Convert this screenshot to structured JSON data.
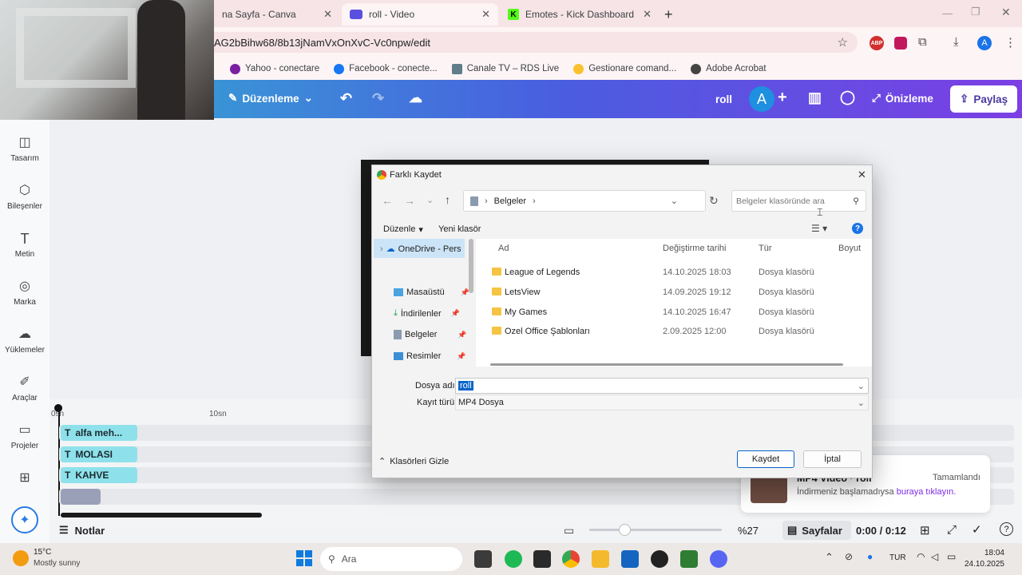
{
  "browser": {
    "tabs": [
      {
        "label": "na Sayfa - Canva"
      },
      {
        "label": "roll - Video"
      },
      {
        "label": "Emotes - Kick Dashboard"
      }
    ],
    "url": "AG2bBihw68/8b13jNamVxOnXvC-Vc0npw/edit",
    "bookmarks": [
      "Yahoo - conectare",
      "Facebook - conecte...",
      "Canale TV – RDS Live",
      "Gestionare comand...",
      "Adobe Acrobat"
    ],
    "colors": {
      "tabbar": "#f6e4e6",
      "toolbar": "#fdf4f5"
    }
  },
  "canva": {
    "header": {
      "edit_menu": "Düzenleme",
      "title": "roll",
      "avatar_letter": "A",
      "preview": "Önizleme",
      "share": "Paylaş"
    },
    "sidebar": [
      "Tasarım",
      "Bileşenler",
      "Metin",
      "Marka",
      "Yüklemeler",
      "Araçlar",
      "Projeler"
    ],
    "timeline": {
      "ticks": [
        "0sn",
        "10sn"
      ],
      "clips": [
        "alfa meh...",
        "MOLASI",
        "KAHVE"
      ]
    },
    "footer": {
      "notes": "Notlar",
      "zoom": "%27",
      "pages": "Sayfalar",
      "time": "0:00 / 0:12"
    },
    "toast": {
      "title": "MP4 Video · roll",
      "status": "Tamamlandı",
      "message": "İndirmeniz başlamadıysa",
      "link": "buraya tıklayın."
    }
  },
  "dialog": {
    "title": "Farklı Kaydet",
    "path": "Belgeler",
    "search_placeholder": "Belgeler klasöründe ara",
    "toolbar": {
      "organize": "Düzenle",
      "new_folder": "Yeni klasör"
    },
    "nav": [
      "OneDrive - Pers",
      "Masaüstü",
      "İndirilenler",
      "Belgeler",
      "Resimler"
    ],
    "columns": {
      "name": "Ad",
      "date": "Değiştirme tarihi",
      "type": "Tür",
      "size": "Boyut"
    },
    "files": [
      {
        "name": "League of Legends",
        "date": "14.10.2025 18:03",
        "type": "Dosya klasörü"
      },
      {
        "name": "LetsView",
        "date": "14.09.2025 19:12",
        "type": "Dosya klasörü"
      },
      {
        "name": "My Games",
        "date": "14.10.2025 16:47",
        "type": "Dosya klasörü"
      },
      {
        "name": "Ozel Office Şablonları",
        "date": "2.09.2025 12:00",
        "type": "Dosya klasörü"
      }
    ],
    "filename_label": "Dosya adı:",
    "filename": "roll",
    "filetype_label": "Kayıt türü:",
    "filetype": "MP4 Dosya",
    "hide_folders": "Klasörleri Gizle",
    "save": "Kaydet",
    "cancel": "İptal"
  },
  "taskbar": {
    "weather_temp": "15°C",
    "weather_desc": "Mostly sunny",
    "search": "Ara",
    "lang": "TUR",
    "time": "18:04",
    "date": "24.10.2025"
  }
}
